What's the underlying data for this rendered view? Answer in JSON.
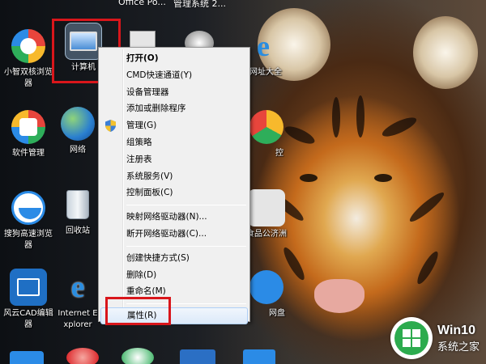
{
  "top_labels": [
    "Office Po...",
    "管理系统 2..."
  ],
  "desktop_icons": {
    "browser_smart": "小智双核浏览器",
    "computer": "计算机",
    "network": "网络",
    "recycle_bin": "回收站",
    "software_manager": "软件管理",
    "sogou": "搜狗高速浏览器",
    "cad": "风云CAD编辑器",
    "ie": "Internet Explorer",
    "net_address": "网址大全",
    "control": "控",
    "food": "食品公济洲",
    "netdisk": "网盘"
  },
  "context_menu": {
    "group1": [
      "打开(O)",
      "CMD快速通道(Y)",
      "设备管理器",
      "添加或删除程序",
      "管理(G)",
      "组策略",
      "注册表",
      "系统服务(V)",
      "控制面板(C)"
    ],
    "group2": [
      "映射网络驱动器(N)...",
      "断开网络驱动器(C)..."
    ],
    "group3": [
      "创建快捷方式(S)",
      "删除(D)",
      "重命名(M)"
    ],
    "group4": [
      "属性(R)"
    ]
  },
  "watermark": {
    "title": "Win10",
    "subtitle": "系统之家"
  },
  "colors": {
    "highlight_box": "#d9161b",
    "menu_bg": "#f0f0f0",
    "watermark_green": "#2cab4e"
  }
}
